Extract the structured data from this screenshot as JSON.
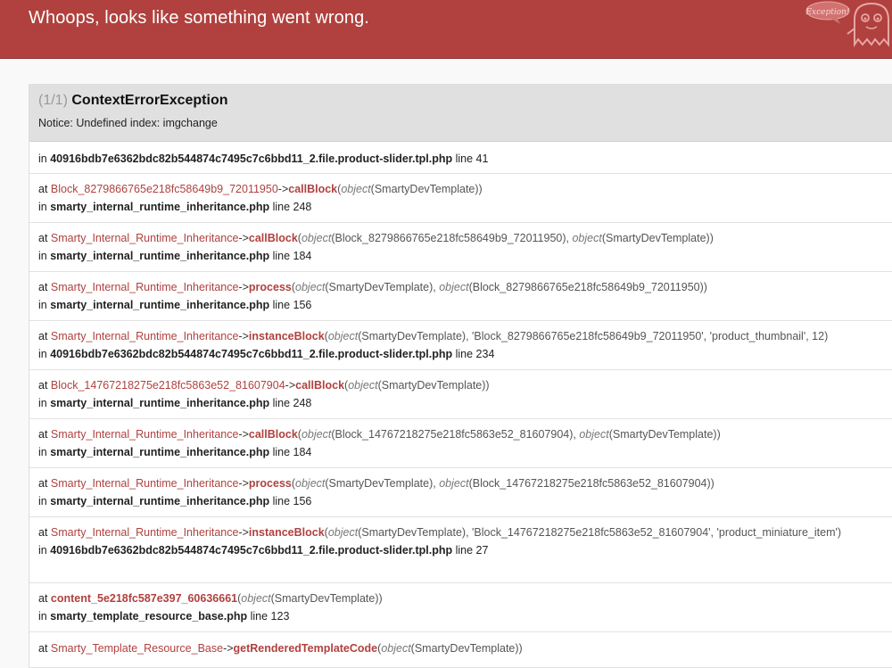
{
  "header": {
    "title": "Whoops, looks like something went wrong.",
    "logo_text": "Exception!",
    "bg_color": "#b0413e"
  },
  "exception": {
    "count": "(1/1)",
    "class": "ContextErrorException",
    "message": "Notice: Undefined index: imgchange"
  },
  "first_location": {
    "prefix": "in",
    "file": "40916bdb7e6362bdc82b544874c7495c7c6bbd11_2.file.product-slider.tpl.php",
    "line": "line 41"
  },
  "trace": [
    {
      "cls": "Block_8279866765e218fc58649b9_72011950",
      "arrow": "->",
      "fn": "callBlock",
      "args_html": "<span class='obj'>object</span>(SmartyDevTemplate)",
      "file": "smarty_internal_runtime_inheritance.php",
      "line": "line 248"
    },
    {
      "cls": "Smarty_Internal_Runtime_Inheritance",
      "arrow": "->",
      "fn": "callBlock",
      "args_html": "<span class='obj'>object</span>(Block_8279866765e218fc58649b9_72011950), <span class='obj'>object</span>(SmartyDevTemplate)",
      "file": "smarty_internal_runtime_inheritance.php",
      "line": "line 184"
    },
    {
      "cls": "Smarty_Internal_Runtime_Inheritance",
      "arrow": "->",
      "fn": "process",
      "args_html": "<span class='obj'>object</span>(SmartyDevTemplate), <span class='obj'>object</span>(Block_8279866765e218fc58649b9_72011950)",
      "file": "smarty_internal_runtime_inheritance.php",
      "line": "line 156"
    },
    {
      "cls": "Smarty_Internal_Runtime_Inheritance",
      "arrow": "->",
      "fn": "instanceBlock",
      "args_html": "<span class='obj'>object</span>(SmartyDevTemplate), 'Block_8279866765e218fc58649b9_72011950', 'product_thumbnail', 12",
      "file": "40916bdb7e6362bdc82b544874c7495c7c6bbd11_2.file.product-slider.tpl.php",
      "line": "line 234"
    },
    {
      "cls": "Block_14767218275e218fc5863e52_81607904",
      "arrow": "->",
      "fn": "callBlock",
      "args_html": "<span class='obj'>object</span>(SmartyDevTemplate)",
      "file": "smarty_internal_runtime_inheritance.php",
      "line": "line 248"
    },
    {
      "cls": "Smarty_Internal_Runtime_Inheritance",
      "arrow": "->",
      "fn": "callBlock",
      "args_html": "<span class='obj'>object</span>(Block_14767218275e218fc5863e52_81607904), <span class='obj'>object</span>(SmartyDevTemplate)",
      "file": "smarty_internal_runtime_inheritance.php",
      "line": "line 184"
    },
    {
      "cls": "Smarty_Internal_Runtime_Inheritance",
      "arrow": "->",
      "fn": "process",
      "args_html": "<span class='obj'>object</span>(SmartyDevTemplate), <span class='obj'>object</span>(Block_14767218275e218fc5863e52_81607904)",
      "file": "smarty_internal_runtime_inheritance.php",
      "line": "line 156"
    },
    {
      "cls": "Smarty_Internal_Runtime_Inheritance",
      "arrow": "->",
      "fn": "instanceBlock",
      "args_html": "<span class='obj'>object</span>(SmartyDevTemplate), 'Block_14767218275e218fc5863e52_81607904', 'product_miniature_item'",
      "file": "40916bdb7e6362bdc82b544874c7495c7c6bbd11_2.file.product-slider.tpl.php",
      "line": "line 27",
      "wrap": true
    },
    {
      "cls": "",
      "arrow": "",
      "fn": "content_5e218fc587e397_60636661",
      "args_html": "<span class='obj'>object</span>(SmartyDevTemplate)",
      "file": "smarty_template_resource_base.php",
      "line": "line 123"
    },
    {
      "cls": "Smarty_Template_Resource_Base",
      "arrow": "->",
      "fn": "getRenderedTemplateCode",
      "args_html": "<span class='obj'>object</span>(SmartyDevTemplate)",
      "file": "",
      "line": ""
    }
  ]
}
